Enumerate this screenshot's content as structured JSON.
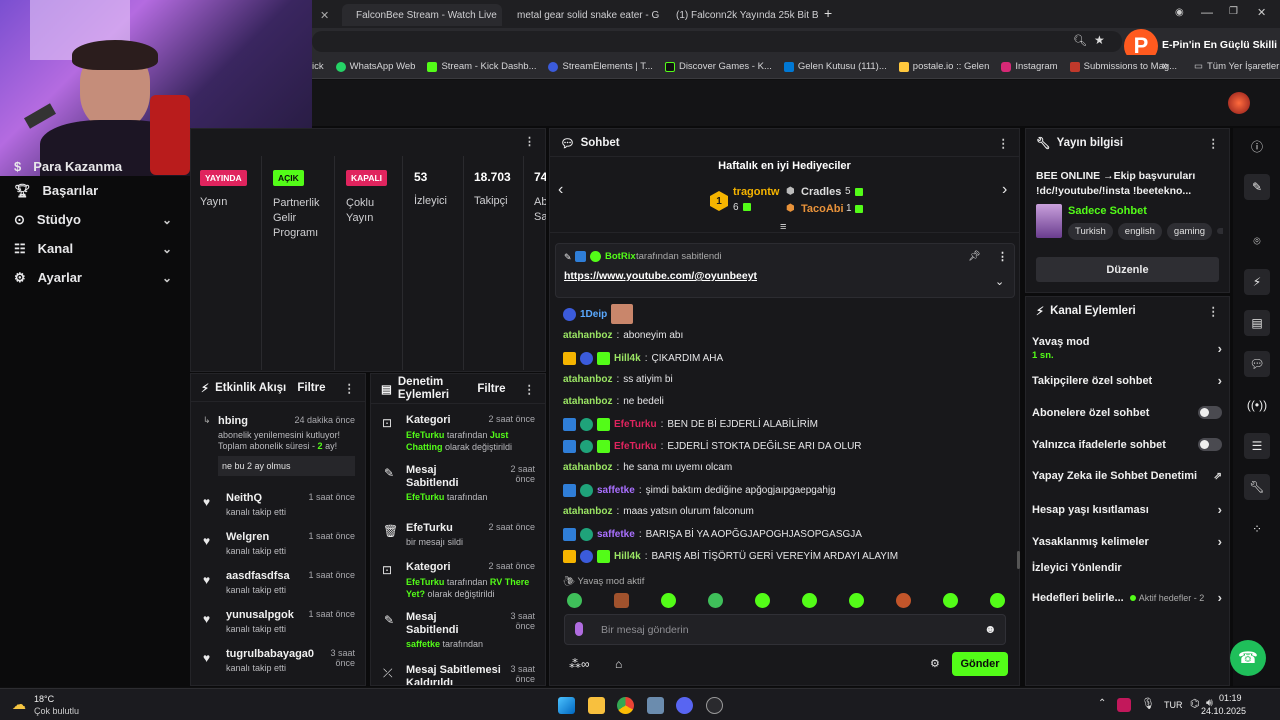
{
  "browser": {
    "tabs": [
      {
        "label": "FalconBee Stream - Watch Live"
      },
      {
        "label": "metal gear solid snake eater - G"
      },
      {
        "label": "(1) Falconn2k Yayında 25k Bit B"
      }
    ],
    "new_tab_label": "+",
    "bookmarks": [
      "ick",
      "WhatsApp Web",
      "Stream - Kick Dashb...",
      "StreamElements | T...",
      "Discover Games - K...",
      "Gelen Kutusu (111)...",
      "postale.io :: Gelen",
      "Instagram",
      "Submissions to Mag..."
    ],
    "bookmarks_more": "»",
    "all_bookmarks_label": "Tüm Yer İşaretleri",
    "promo_text": "E-Pin'in En Güçlü Skilli",
    "promo_letter": "P"
  },
  "sidenav": {
    "items": [
      {
        "label": "Para Kazanma",
        "icon": "money-icon",
        "expandable": false
      },
      {
        "label": "Başarılar",
        "icon": "trophy-icon",
        "expandable": false
      },
      {
        "label": "Stüdyo",
        "icon": "studio-icon",
        "expandable": true
      },
      {
        "label": "Kanal",
        "icon": "channel-icon",
        "expandable": true
      },
      {
        "label": "Ayarlar",
        "icon": "gear-icon",
        "expandable": true
      }
    ]
  },
  "stats": {
    "yayin_badge": "YAYINDA",
    "yayin_label": "Yayın",
    "partner_badge": "AÇIK",
    "partner_label": "Partnerlik Gelir Programı",
    "multi_badge": "KAPALI",
    "multi_label": "Çoklu Yayın",
    "viewers": "53",
    "viewers_label": "İzleyici",
    "followers": "18.703",
    "followers_label": "Takipçi",
    "subs": "74",
    "subs_label": "Ab Sa"
  },
  "activity": {
    "title": "Etkinlik Akışı",
    "filter_label": "Filtre",
    "events": [
      {
        "name": "hbing",
        "time": "24 dakika önce",
        "sub": "abonelik yenilemesini kutluyor!",
        "sub2": "Toplam abonelik süresi - ",
        "months": "2",
        "months_suffix": " ay!",
        "message": "ne bu 2 ay olmus"
      },
      {
        "name": "NeithQ",
        "time": "1 saat önce",
        "sub": "kanalı takip etti"
      },
      {
        "name": "Welgren",
        "time": "1 saat önce",
        "sub": "kanalı takip etti"
      },
      {
        "name": "aasdfasdfsa",
        "time": "1 saat önce",
        "sub": "kanalı takip etti"
      },
      {
        "name": "yunusalpgok",
        "time": "1 saat önce",
        "sub": "kanalı takip etti"
      },
      {
        "name": "tugrulbabayaga0",
        "time": "3 saat önce",
        "sub": "kanalı takip etti"
      }
    ]
  },
  "moderation": {
    "title": "Denetim Eylemleri",
    "filter_label": "Filtre",
    "events": [
      {
        "name": "Kategori",
        "time": "2 saat önce",
        "actor": "EfeTurku",
        "text": " tarafından ",
        "target": "Just Chatting",
        "tail": " olarak değiştirildi"
      },
      {
        "name": "Mesaj Sabitlendi",
        "time": "2 saat önce",
        "actor": "EfeTurku",
        "text": " tarafından"
      },
      {
        "name": "EfeTurku",
        "time": "2 saat önce",
        "text": "bir mesajı sildi"
      },
      {
        "name": "Kategori",
        "time": "2 saat önce",
        "actor": "EfeTurku",
        "text": " tarafından ",
        "target": "RV There Yet?",
        "tail": " olarak değiştirildi"
      },
      {
        "name": "Mesaj Sabitlendi",
        "time": "3 saat önce",
        "actor": "saffetke",
        "text": " tarafından"
      },
      {
        "name": "Mesaj Sabitlemesi Kaldırıldı",
        "time": "3 saat önce"
      }
    ]
  },
  "chat": {
    "title": "Sohbet",
    "gifters_title": "Haftalık en iyi Hediyeciler",
    "gifters": [
      {
        "rank": "1",
        "name": "tragontw",
        "count": "6"
      },
      {
        "name": "Cradles",
        "count": "5"
      },
      {
        "name": "TacoAbi",
        "count": "1"
      }
    ],
    "pinned_by": "BotRix",
    "pinned_text": "tarafından sabitlendi",
    "pinned_link": "https://www.youtube.com/@oyunbeeyt",
    "messages": [
      {
        "user": "1Deip",
        "text": "",
        "color": "#53fc18"
      },
      {
        "user": "atahanboz",
        "text": "aboneyim abı",
        "color": "#9be564"
      },
      {
        "user": "Hill4k",
        "text": "ÇIKARDIM AHA",
        "color": "#9be564"
      },
      {
        "user": "atahanboz",
        "text": "ss atiyim bi",
        "color": "#9be564"
      },
      {
        "user": "atahanboz",
        "text": "ne bedeli",
        "color": "#9be564"
      },
      {
        "user": "EfeTurku",
        "text": "BEN DE Bİ EJDERLİ ALABİLİRİM",
        "color": "#e0245e"
      },
      {
        "user": "EfeTurku",
        "text": "EJDERLİ STOKTA DEĞİLSE ARI DA OLUR",
        "color": "#e0245e"
      },
      {
        "user": "atahanboz",
        "text": "he sana mı uyemı olcam",
        "color": "#9be564"
      },
      {
        "user": "saffetke",
        "text": "şimdi baktım dediğine apğogjaıpgaepgahjg",
        "color": "#a970ff"
      },
      {
        "user": "atahanboz",
        "text": "maas yatsın olurum falconum",
        "color": "#9be564"
      },
      {
        "user": "saffetke",
        "text": "BARIŞA Bİ YA AOPĞGJAPOGHJASOPGASGJA",
        "color": "#a970ff"
      },
      {
        "user": "Hill4k",
        "text": "BARIŞ ABİ TİŞÖRTÜ GERİ VEREYİM ARDAYI ALAYIM",
        "color": "#9be564"
      }
    ],
    "slow_mode_text": "Yavaş mod aktif",
    "input_placeholder": "Bir mesaj gönderin",
    "send_label": "Gönder"
  },
  "stream_info": {
    "title": "Yayın bilgisi",
    "stream_title": "BEE ONLINE →Ekip başvuruları !dc/!youtube/!insta !beetekno...",
    "category": "Sadece Sohbet",
    "tags": [
      "Turkish",
      "english",
      "gaming"
    ],
    "edit_label": "Düzenle"
  },
  "channel_actions": {
    "title": "Kanal Eylemleri",
    "slow_mode": "Yavaş mod",
    "slow_mode_value": "1 sn.",
    "followers_only": "Takipçilere özel sohbet",
    "subs_only": "Abonelere özel sohbet",
    "emotes_only": "Yalnızca ifadelerle sohbet",
    "ai_moderation": "Yapay Zeka ile Sohbet Denetimi",
    "age_restriction": "Hesap yaşı kısıtlaması",
    "banned_words": "Yasaklanmış kelimeler",
    "redirect": "İzleyici Yönlendir",
    "goals": "Hedefleri belirle...",
    "goals_status": "Aktif hedefler - 2"
  },
  "taskbar": {
    "weather_temp": "18°C",
    "weather_desc": "Çok bulutlu",
    "lang": "TUR",
    "time": "01:19",
    "date": "24.10.2025"
  },
  "colors": {
    "accent": "#53fc18",
    "live": "#e0245e",
    "panel": "#18181b"
  }
}
